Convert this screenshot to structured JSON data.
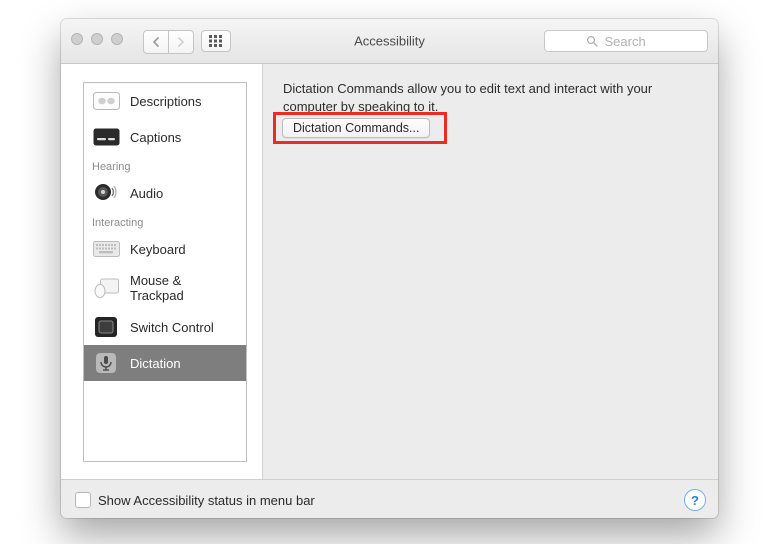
{
  "window": {
    "title": "Accessibility",
    "search_placeholder": "Search"
  },
  "sidebar": {
    "sections": [
      {
        "label": null,
        "items": [
          {
            "id": "descriptions",
            "label": "Descriptions"
          },
          {
            "id": "captions",
            "label": "Captions"
          }
        ]
      },
      {
        "label": "Hearing",
        "items": [
          {
            "id": "audio",
            "label": "Audio"
          }
        ]
      },
      {
        "label": "Interacting",
        "items": [
          {
            "id": "keyboard",
            "label": "Keyboard"
          },
          {
            "id": "mouse-trackpad",
            "label": "Mouse & Trackpad"
          },
          {
            "id": "switch-control",
            "label": "Switch Control"
          },
          {
            "id": "dictation",
            "label": "Dictation",
            "selected": true
          }
        ]
      }
    ]
  },
  "content": {
    "description": "Dictation Commands allow you to edit text and interact with your computer by speaking to it.",
    "button_label": "Dictation Commands..."
  },
  "footer": {
    "checkbox_label": "Show Accessibility status in menu bar",
    "help_label": "?"
  }
}
